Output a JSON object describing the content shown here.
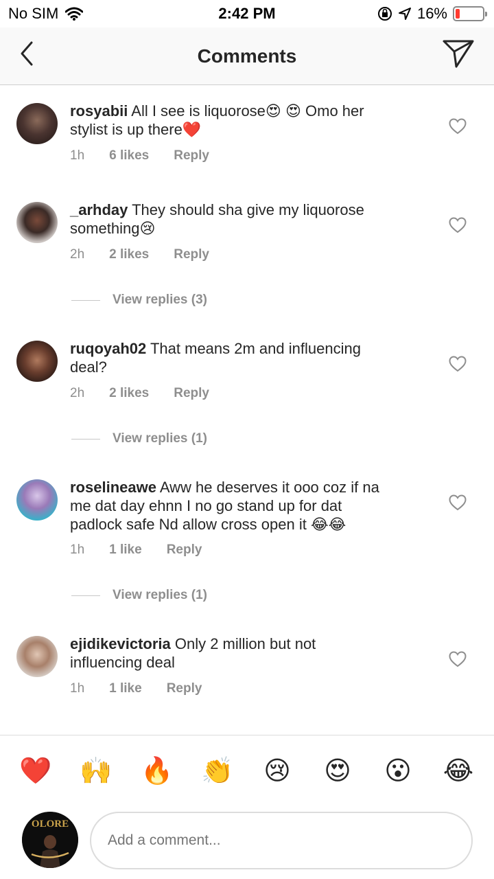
{
  "status_bar": {
    "carrier": "No SIM",
    "time": "2:42 PM",
    "battery": "16%",
    "battery_level": 0.16,
    "icons": [
      "wifi-icon",
      "orientation-lock-icon",
      "location-arrow-icon",
      "battery-icon"
    ]
  },
  "header": {
    "title": "Comments",
    "back_icon": "chevron-left-icon",
    "send_icon": "paper-plane-icon"
  },
  "comments": [
    {
      "username": "rosyabii",
      "line1": " All I see is liquorose😍 😍 Omo her",
      "line2": "stylist is up there❤️",
      "line3": "",
      "time": "1h",
      "likes": "6 likes",
      "reply": "Reply",
      "view_replies": ""
    },
    {
      "username": "_arhday",
      "line1": " They should sha give my liquorose",
      "line2": "something😢",
      "line3": "",
      "time": "2h",
      "likes": "2 likes",
      "reply": "Reply",
      "view_replies": "View replies (3)"
    },
    {
      "username": "ruqoyah02",
      "line1": " That means 2m and influencing",
      "line2": "deal?",
      "line3": "",
      "time": "2h",
      "likes": "2 likes",
      "reply": "Reply",
      "view_replies": "View replies (1)"
    },
    {
      "username": "roselineawe",
      "line1": " Aww he deserves it ooo coz if na",
      "line2": "me dat day ehnn I no go stand up for dat",
      "line3": "padlock safe Nd allow cross open it 😂😂",
      "time": "1h",
      "likes": "1 like",
      "reply": "Reply",
      "view_replies": "View replies (1)"
    },
    {
      "username": "ejidikevictoria",
      "line1": " Only 2 million but not",
      "line2": "influencing deal",
      "line3": "",
      "time": "1h",
      "likes": "1 like",
      "reply": "Reply",
      "view_replies": ""
    }
  ],
  "reactions": [
    "❤️",
    "🙌",
    "🔥",
    "👏",
    "😢",
    "😍",
    "😮",
    "😂"
  ],
  "composer": {
    "placeholder": "Add a comment...",
    "avatar_text": "OLORE"
  },
  "colors": {
    "text": "#262626",
    "secondary": "#8e8e8e",
    "battery_low": "#ff3b30",
    "header_bg": "#f9f9f9"
  }
}
